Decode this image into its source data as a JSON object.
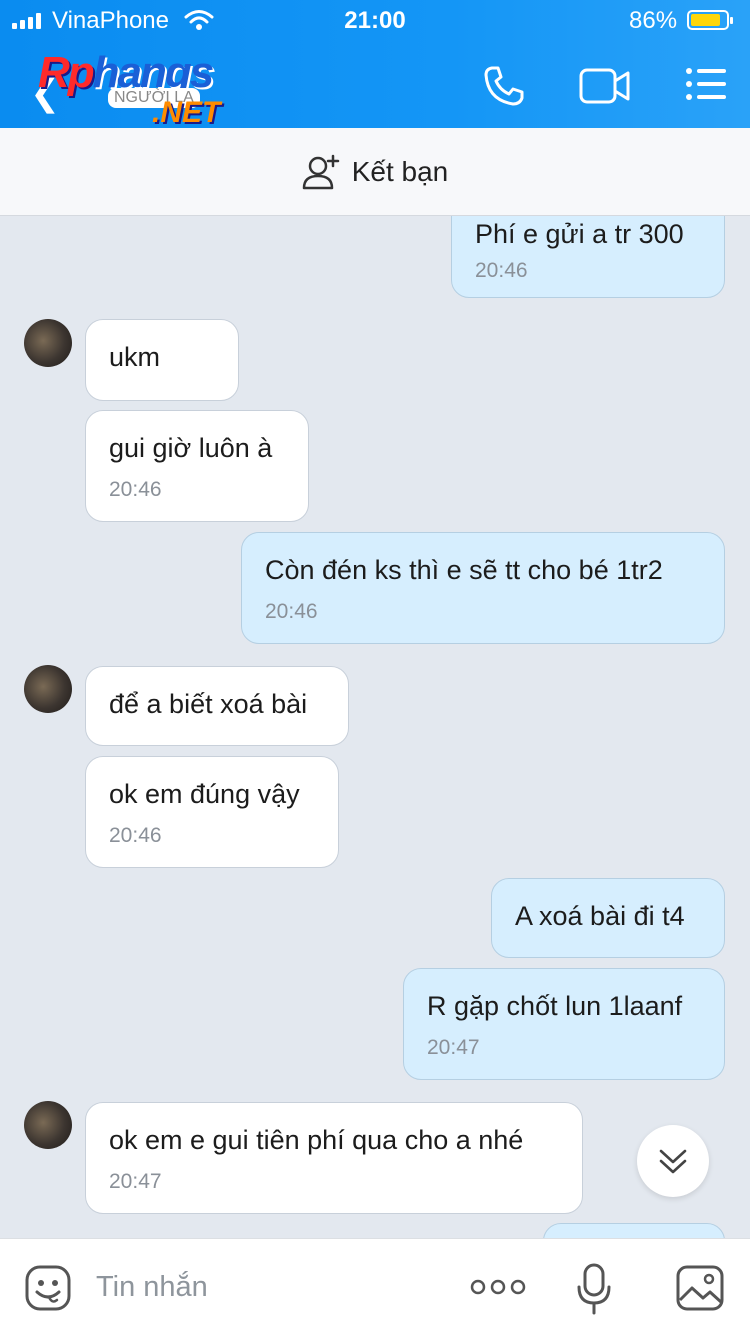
{
  "status_bar": {
    "carrier": "VinaPhone",
    "time": "21:00",
    "battery_percent": "86%",
    "battery_level": 0.86
  },
  "header": {
    "logo": {
      "brand_a": "Rp",
      "brand_b": "hangs",
      "tagline": "NGƯỜI LẠ",
      "suffix": ".NET"
    },
    "icons": [
      "back-icon",
      "phone-icon",
      "video-call-icon",
      "menu-icon"
    ]
  },
  "friend_bar": {
    "label": "Kết bạn",
    "icon": "add-friend-icon"
  },
  "messages": [
    {
      "dir": "out",
      "text": "Phí e gửi a tr 300",
      "time": "20:46"
    },
    {
      "dir": "in",
      "text": "ukm",
      "time": "",
      "avatar": true
    },
    {
      "dir": "in",
      "text": "gui giờ luôn à",
      "time": "20:46"
    },
    {
      "dir": "out",
      "text": "Còn đén ks thì e sẽ tt cho bé 1tr2",
      "time": "20:46"
    },
    {
      "dir": "in",
      "text": "để a biết xoá bài",
      "time": "",
      "avatar": true
    },
    {
      "dir": "in",
      "text": "ok em đúng vậy",
      "time": "20:46"
    },
    {
      "dir": "out",
      "text": "A xoá bài đi t4",
      "time": ""
    },
    {
      "dir": "out",
      "text": "R gặp chốt lun 1laanf",
      "time": "20:47"
    },
    {
      "dir": "in",
      "text": "ok em e gui tiên phí qua cho a nhé",
      "time": "20:47",
      "avatar": true
    }
  ],
  "composer": {
    "placeholder": "Tin nhắn",
    "icons": [
      "emoji-icon",
      "more-icon",
      "mic-icon",
      "image-icon"
    ]
  },
  "colors": {
    "header_blue": "#1496f6",
    "outgoing_bubble": "#d6eefe",
    "incoming_bubble": "#ffffff",
    "chat_bg": "#e3e8ef",
    "battery": "#ffd60a"
  }
}
